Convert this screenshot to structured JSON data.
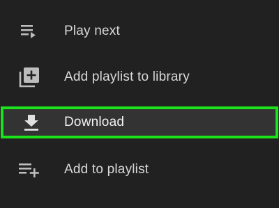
{
  "menu": {
    "items": [
      {
        "label": "Play next",
        "icon": "play-next-icon"
      },
      {
        "label": "Add playlist to library",
        "icon": "library-add-icon"
      },
      {
        "label": "Download",
        "icon": "download-icon",
        "highlighted": true
      },
      {
        "label": "Add to playlist",
        "icon": "playlist-add-icon"
      }
    ]
  },
  "colors": {
    "background": "#212121",
    "highlight_row": "#333333",
    "highlight_border": "#1be21b",
    "text": "#d9d9d9",
    "icon": "#bdbdbd"
  }
}
